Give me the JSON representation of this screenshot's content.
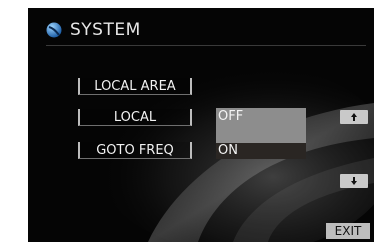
{
  "header": {
    "title": "SYSTEM",
    "logo_icon": "globe-icon"
  },
  "menu": {
    "local_area": "LOCAL AREA",
    "local": "LOCAL",
    "goto_freq": "GOTO FREQ"
  },
  "options": {
    "off": "OFF",
    "on": "ON",
    "highlight_color": "#8d8d8d"
  },
  "buttons": {
    "up_icon": "arrow-up-icon",
    "down_icon": "arrow-down-icon",
    "exit": "EXIT"
  }
}
